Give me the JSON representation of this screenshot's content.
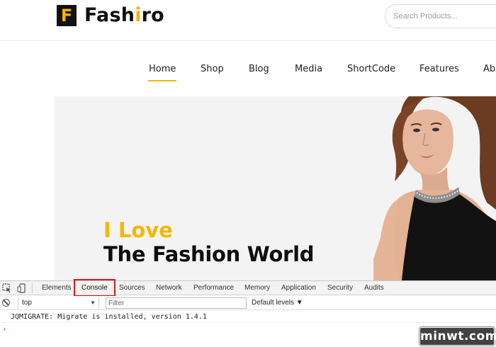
{
  "site": {
    "logo_letter": "F",
    "logo_text_prefix": "Fash",
    "logo_text_accent": "i",
    "logo_text_suffix": "ro",
    "search_placeholder": "Search Products..."
  },
  "nav": {
    "items": [
      {
        "label": "Home",
        "active": true
      },
      {
        "label": "Shop"
      },
      {
        "label": "Blog"
      },
      {
        "label": "Media"
      },
      {
        "label": "ShortCode"
      },
      {
        "label": "Features"
      },
      {
        "label": "Ab"
      }
    ]
  },
  "hero": {
    "line1": "I Love",
    "line2": "The Fashion World"
  },
  "devtools": {
    "tabs": [
      "Elements",
      "Console",
      "Sources",
      "Network",
      "Performance",
      "Memory",
      "Application",
      "Security",
      "Audits"
    ],
    "selected_tab": "Console",
    "context": "top",
    "context_caret": "▼",
    "filter_placeholder": "Filter",
    "levels": "Default levels ▼",
    "messages": [
      "JQMIGRATE: Migrate is installed, version 1.4.1"
    ],
    "prompt": "›"
  },
  "watermark": "minwt.com",
  "colors": {
    "accent": "#f4b400",
    "highlight_box": "#e0171f",
    "console_prompt": "#3b7df5"
  }
}
